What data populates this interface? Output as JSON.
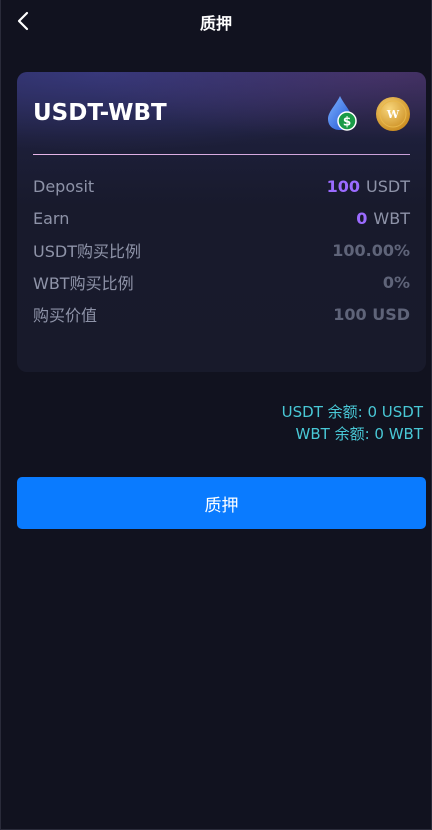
{
  "header": {
    "title": "质押"
  },
  "card": {
    "pair_title": "USDT-WBT",
    "rows": [
      {
        "label": "Deposit",
        "value": "100",
        "unit": "USDT"
      },
      {
        "label": "Earn",
        "value": "0",
        "unit": "WBT"
      },
      {
        "label": "USDT购买比例",
        "value": "100.00%"
      },
      {
        "label": "WBT购买比例",
        "value": "0%"
      },
      {
        "label": "购买价值",
        "value": "100 USD"
      }
    ]
  },
  "balances": {
    "usdt": "USDT 余额: 0 USDT",
    "wbt": "WBT 余额: 0 WBT"
  },
  "stake_button": {
    "label": "质押"
  },
  "colors": {
    "background": "#11121f",
    "accent_purple": "#9b6bff",
    "button_blue": "#0a7bff",
    "balance_cyan": "#49c8d6"
  },
  "icons": {
    "back": "chevron-left-icon",
    "usdt": "usdt-token-icon",
    "wbt": "wbt-token-icon"
  }
}
